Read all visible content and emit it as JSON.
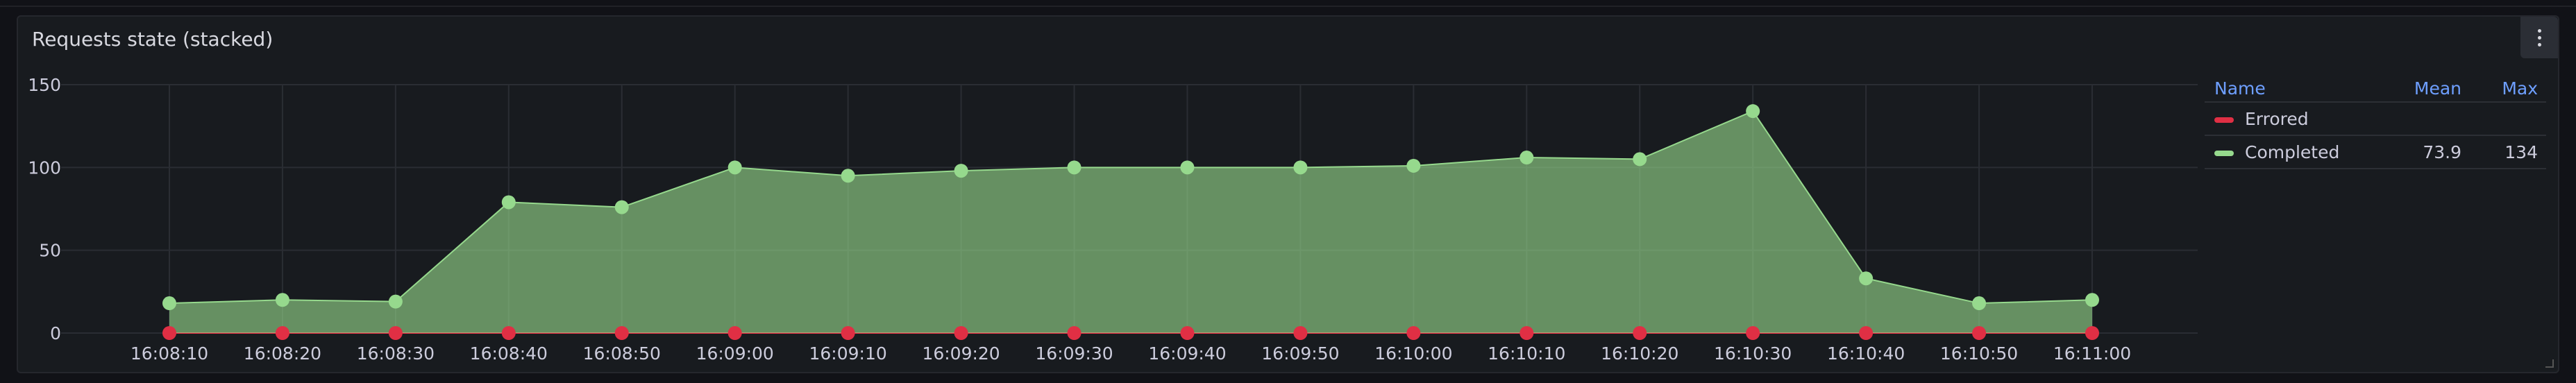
{
  "panel": {
    "title": "Requests state (stacked)"
  },
  "legend": {
    "headers": {
      "name": "Name",
      "mean": "Mean",
      "max": "Max"
    },
    "rows": [
      {
        "name": "Errored",
        "mean": "",
        "max": "",
        "color": "#e02f44"
      },
      {
        "name": "Completed",
        "mean": "73.9",
        "max": "134",
        "color": "#96d98d"
      }
    ]
  },
  "chart_data": {
    "type": "area",
    "stacked": true,
    "x": [
      "16:08:10",
      "16:08:20",
      "16:08:30",
      "16:08:40",
      "16:08:50",
      "16:09:00",
      "16:09:10",
      "16:09:20",
      "16:09:30",
      "16:09:40",
      "16:09:50",
      "16:10:00",
      "16:10:10",
      "16:10:20",
      "16:10:30",
      "16:10:40",
      "16:10:50",
      "16:11:00"
    ],
    "series": [
      {
        "name": "Errored",
        "color": "#e02f44",
        "values": [
          0,
          0,
          0,
          0,
          0,
          0,
          0,
          0,
          0,
          0,
          0,
          0,
          0,
          0,
          0,
          0,
          0,
          0
        ]
      },
      {
        "name": "Completed",
        "color": "#96d98d",
        "values": [
          18,
          20,
          19,
          79,
          76,
          100,
          95,
          98,
          100,
          100,
          100,
          101,
          106,
          105,
          134,
          33,
          18,
          20
        ]
      }
    ],
    "yticks": [
      0,
      50,
      100,
      150
    ],
    "ylim": [
      0,
      150
    ],
    "grid": true,
    "legend_position": "right"
  }
}
